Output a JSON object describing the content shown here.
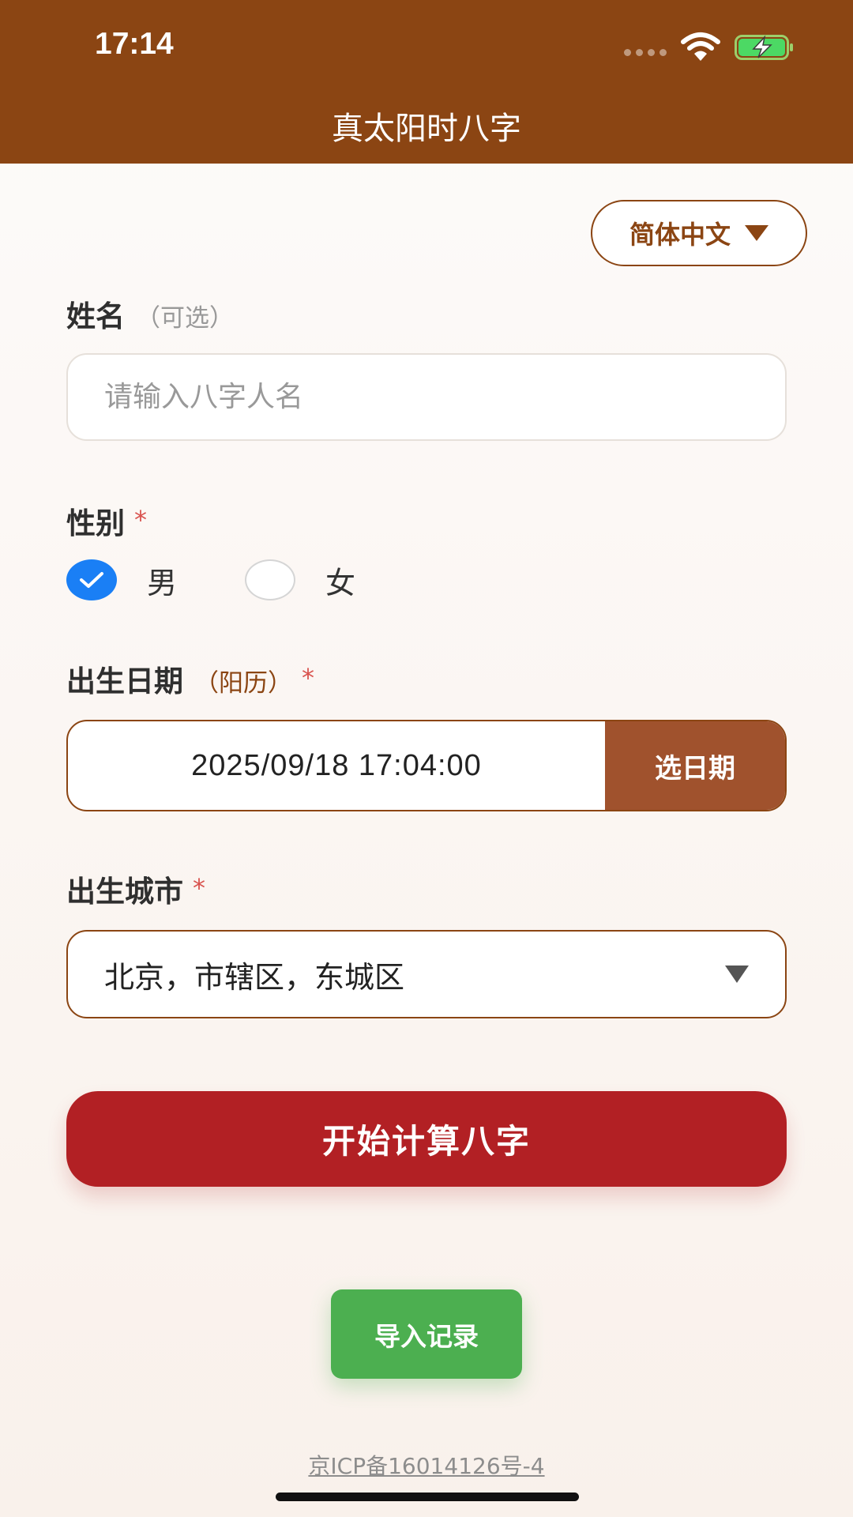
{
  "status_bar": {
    "time": "17:14"
  },
  "header": {
    "title": "真太阳时八字"
  },
  "language": {
    "selected": "简体中文"
  },
  "name_section": {
    "label": "姓名",
    "hint": "（可选）",
    "placeholder": "请输入八字人名",
    "value": ""
  },
  "gender_section": {
    "label": "性别",
    "required_mark": "*",
    "options": [
      {
        "label": "男",
        "checked": true
      },
      {
        "label": "女",
        "checked": false
      }
    ]
  },
  "date_section": {
    "label": "出生日期",
    "hint": "（阳历）",
    "required_mark": "*",
    "value": "2025/09/18 17:04:00",
    "button_label": "选日期"
  },
  "city_section": {
    "label": "出生城市",
    "required_mark": "*",
    "value": "北京，市辖区，东城区"
  },
  "actions": {
    "calculate_label": "开始计算八字",
    "import_label": "导入记录"
  },
  "footer": {
    "icp": "京ICP备16014126号-4"
  },
  "colors": {
    "primary_brown": "#8b4513",
    "date_button": "#a0522d",
    "calculate_red": "#b22024",
    "import_green": "#4caf50",
    "radio_checked": "#1a7ff5",
    "required_red": "#d9534f"
  },
  "icons": [
    "wifi-icon",
    "battery-charging-icon",
    "checkmark-icon",
    "dropdown-triangle-icon"
  ]
}
